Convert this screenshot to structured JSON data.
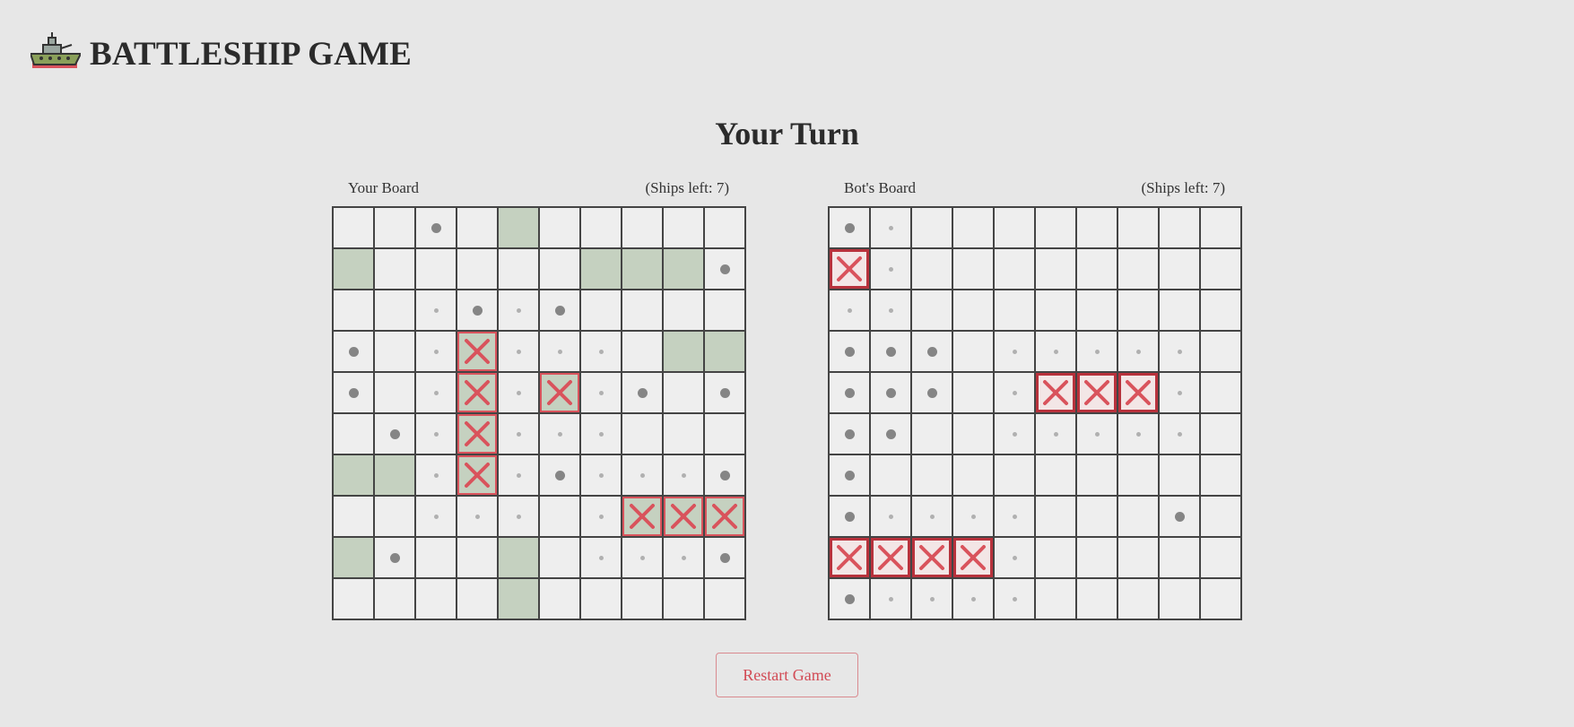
{
  "header": {
    "title": "BATTLESHIP GAME",
    "logo_icon": "battleship-icon"
  },
  "status": {
    "turn_text": "Your Turn"
  },
  "colors": {
    "background": "#e7e7e7",
    "ship": "#c5d1c0",
    "hit_mark": "#d9535c",
    "hit_border_bot": "#b8323c",
    "miss_dot": "#858585",
    "near_dot": "#b0b0b0"
  },
  "legend": {
    ".": "empty",
    "S": "ship",
    "X": "hit",
    "O": "miss",
    "o": "revealed empty"
  },
  "boards": {
    "player": {
      "label": "Your Board",
      "ships_left": "(Ships left: 7)",
      "rows": [
        "..O.S.....",
        "S.....SSSO",
        "..oOoO....",
        "O.oXooo.SS.",
        "O.oXoXoO.O",
        ".OoXooo...",
        "SSoXoOoooO",
        "..ooo.oXXX",
        "SO..S.oooO",
        "....S....."
      ]
    },
    "bot": {
      "label": "Bot's Board",
      "ships_left": "(Ships left: 7)",
      "rows": [
        "Oo........",
        "Xo........",
        "oo........",
        "OOO.ooooo.",
        "OOO.oXXXo.",
        "OO..ooooo.",
        "O.........",
        "Ooooo...O.",
        "XXXXo.....",
        "Ooooo....."
      ]
    }
  },
  "controls": {
    "restart_label": "Restart Game"
  }
}
